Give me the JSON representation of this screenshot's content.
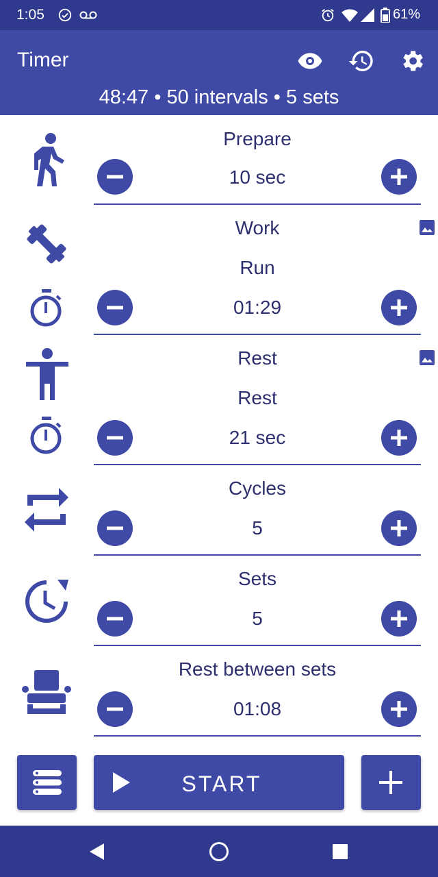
{
  "status_bar": {
    "time": "1:05",
    "battery": "61%",
    "icons": [
      "check-circle-icon",
      "voicemail-icon",
      "alarm-icon",
      "wifi-icon",
      "signal-icon",
      "battery-icon"
    ]
  },
  "app_bar": {
    "title": "Timer",
    "summary": "48:47 • 50 intervals • 5 sets",
    "actions": [
      "eye-icon",
      "history-icon",
      "settings-icon"
    ]
  },
  "rows": {
    "prepare": {
      "label": "Prepare",
      "value": "10 sec"
    },
    "work": {
      "label": "Work",
      "name": "Run",
      "value": "01:29"
    },
    "rest": {
      "label": "Rest",
      "name": "Rest",
      "value": "21 sec"
    },
    "cycles": {
      "label": "Cycles",
      "value": "5"
    },
    "sets": {
      "label": "Sets",
      "value": "5"
    },
    "rest_between_sets": {
      "label": "Rest between sets",
      "value": "01:08"
    }
  },
  "bottom": {
    "start_label": "START"
  },
  "colors": {
    "primary": "#3f4aa6",
    "status_bar": "#2f3a8f",
    "text": "#2d2f6e",
    "background": "#ffffff"
  }
}
